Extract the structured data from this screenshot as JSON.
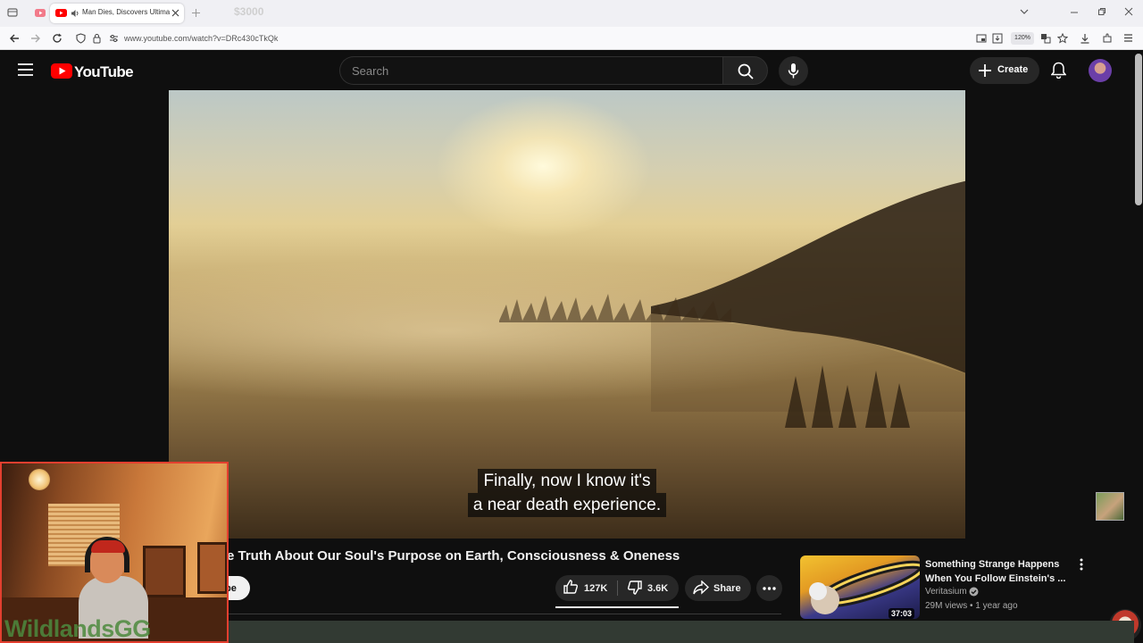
{
  "browser": {
    "active_tab_title": "Man Dies, Discovers Ultimate",
    "ghost_tab_text": "$3000",
    "url": "www.youtube.com/watch?v=DRc430cTkQk",
    "zoom": "120%"
  },
  "header": {
    "logo_text": "YouTube",
    "search_placeholder": "Search",
    "create_label": "Create"
  },
  "video": {
    "subtitle_line_1": "Finally, now I know it's",
    "subtitle_line_2": "a near death experience.",
    "title": "e Truth About Our Soul's Purpose on Earth, Consciousness & Oneness"
  },
  "actions": {
    "subscribe_partial": "be",
    "like_count": "127K",
    "dislike_count": "3.6K",
    "share_label": "Share"
  },
  "recommendation": {
    "title": "Something Strange Happens When You Follow Einstein's ...",
    "channel": "Veritasium",
    "views": "29M views",
    "age": "1 year ago",
    "meta": "29M views • 1 year ago",
    "duration": "37:03"
  },
  "webcam": {
    "watermark": "WildlandsGG"
  },
  "colors": {
    "youtube_red": "#ff0000",
    "webcam_border": "#e33f2f",
    "background": "#0f0f0f"
  }
}
